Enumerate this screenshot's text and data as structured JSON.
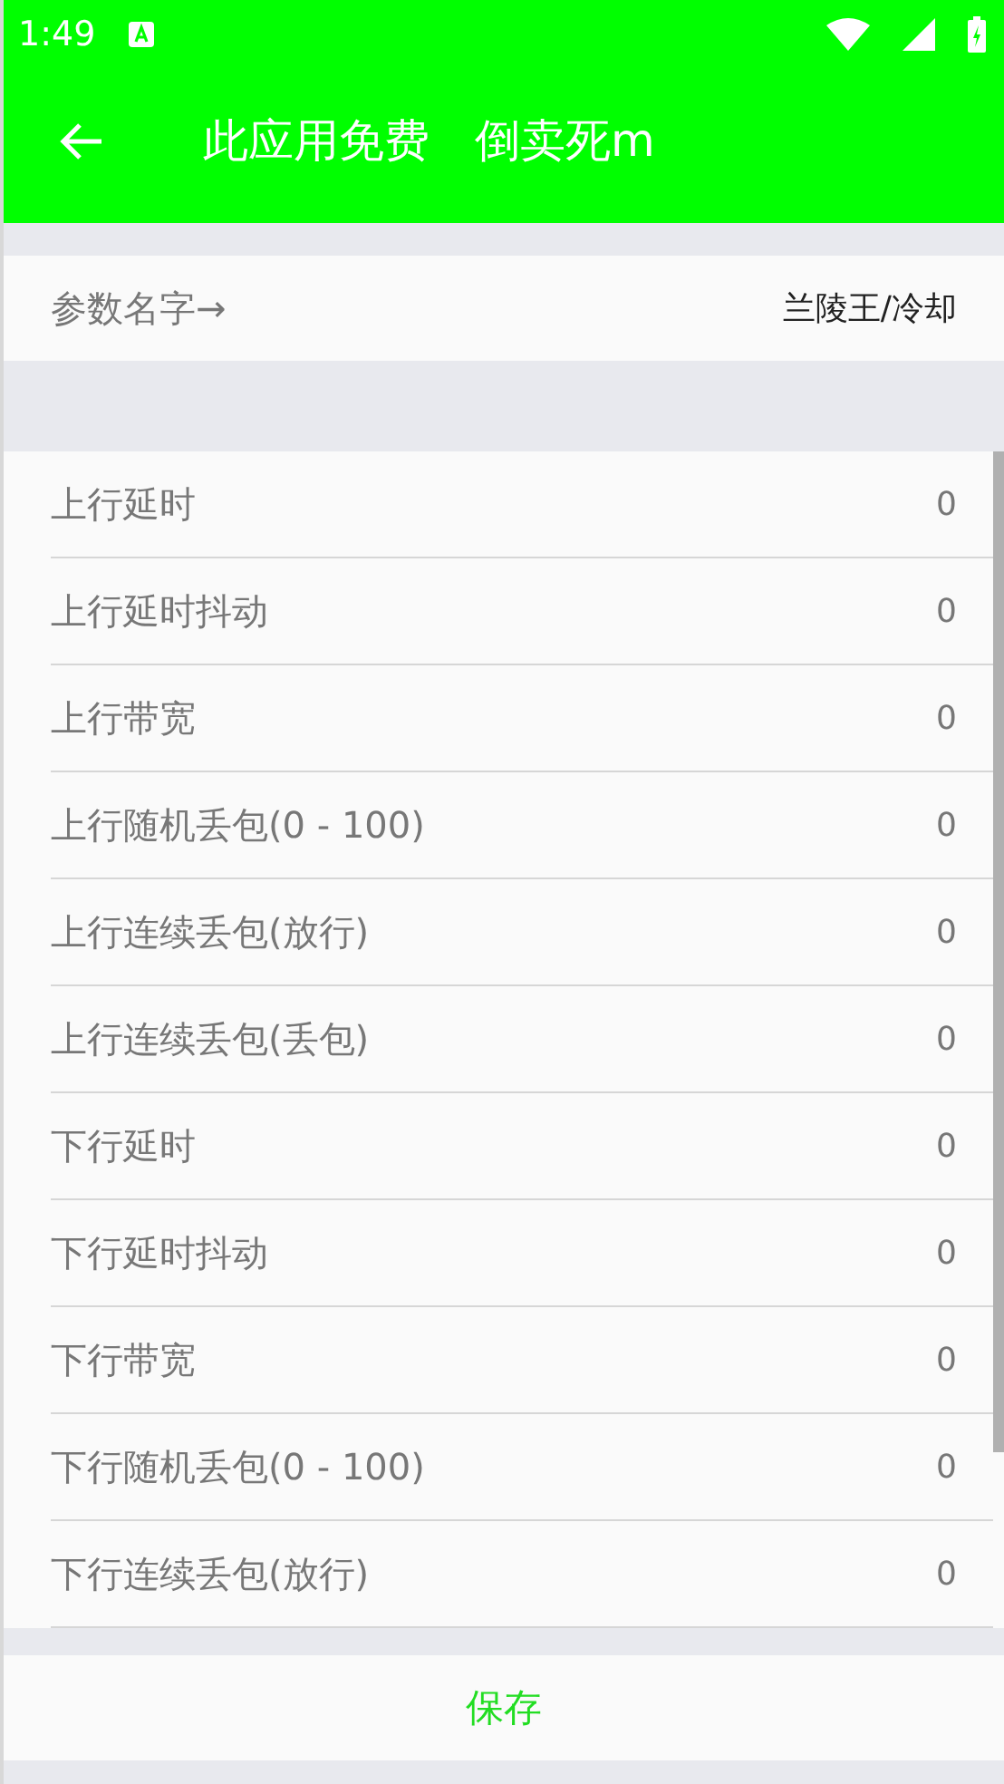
{
  "status_bar": {
    "time": "1:49"
  },
  "app_bar": {
    "title": "此应用免费　倒卖死m"
  },
  "param_name": {
    "label": "参数名字→",
    "value": "兰陵王/冷却"
  },
  "settings": [
    {
      "label": "上行延时",
      "value": "0"
    },
    {
      "label": "上行延时抖动",
      "value": "0"
    },
    {
      "label": "上行带宽",
      "value": "0"
    },
    {
      "label": "上行随机丢包(0 - 100)",
      "value": "0"
    },
    {
      "label": "上行连续丢包(放行)",
      "value": "0"
    },
    {
      "label": "上行连续丢包(丢包)",
      "value": "0"
    },
    {
      "label": "下行延时",
      "value": "0"
    },
    {
      "label": "下行延时抖动",
      "value": "0"
    },
    {
      "label": "下行带宽",
      "value": "0"
    },
    {
      "label": "下行随机丢包(0 - 100)",
      "value": "0"
    },
    {
      "label": "下行连续丢包(放行)",
      "value": "0"
    }
  ],
  "save_button": {
    "label": "保存"
  }
}
